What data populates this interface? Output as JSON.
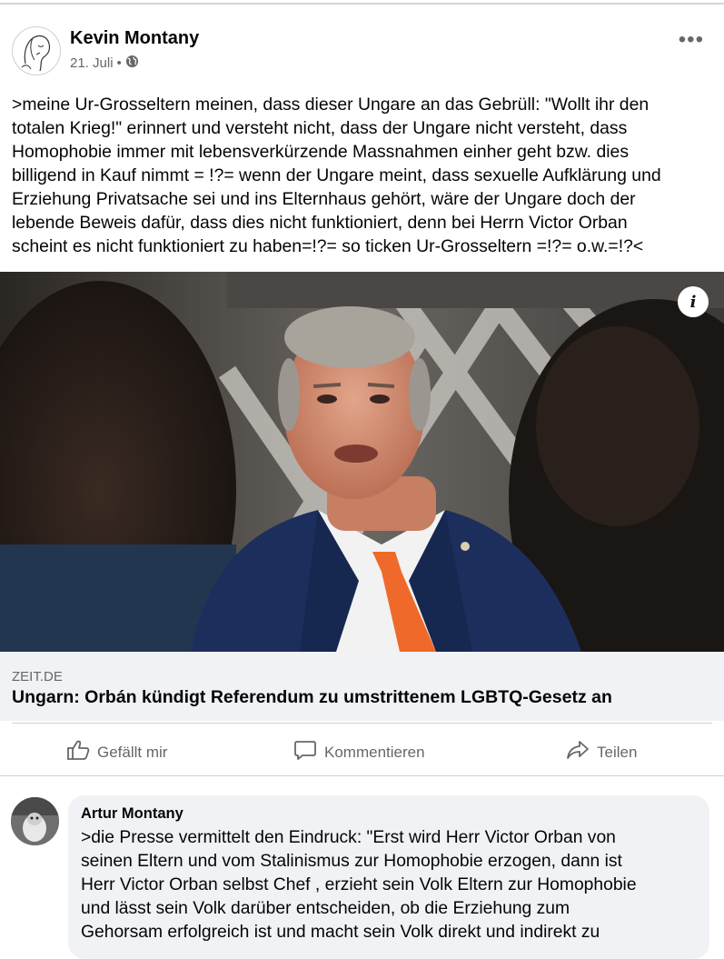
{
  "post": {
    "author": "Kevin Montany",
    "date": "21. Juli",
    "date_separator": "•",
    "audience_icon": "globe-icon",
    "more_icon": "more-horizontal-icon",
    "more_label": "•••",
    "text": ">meine Ur-Grosseltern meinen, dass dieser Ungare an das Gebrüll: \"Wollt ihr den\ntotalen Krieg!\" erinnert und versteht nicht, dass der Ungare nicht versteht, dass\nHomophobie immer mit lebensverkürzende Massnahmen einher geht bzw. dies\nbilligend in Kauf nimmt = !?= wenn der Ungare meint, dass sexuelle Aufklärung und\nErziehung Privatsache sei und ins Elternhaus gehört, wäre der Ungare doch der\nlebende Beweis dafür, dass dies nicht funktioniert, denn bei Herrn Victor Orban\nscheint es nicht funktioniert zu haben=!?= so ticken Ur-Grosseltern =!?= o.w.=!?<"
  },
  "link": {
    "info_label": "i",
    "domain": "ZEIT.DE",
    "title": "Ungarn: Orbán kündigt Referendum zu umstrittenem LGBTQ-Gesetz an"
  },
  "actions": {
    "like": {
      "label": "Gefällt mir",
      "icon": "thumbs-up-icon"
    },
    "comment": {
      "label": "Kommentieren",
      "icon": "comment-icon"
    },
    "share": {
      "label": "Teilen",
      "icon": "share-icon"
    }
  },
  "comment": {
    "author": "Artur Montany",
    "text": ">die Presse vermittelt den Eindruck: \"Erst wird Herr Victor Orban von\nseinen Eltern und vom Stalinismus zur Homophobie erzogen, dann ist\nHerr Victor Orban selbst Chef , erzieht sein Volk Eltern zur Homophobie\nund lässt sein Volk darüber entscheiden, ob die Erziehung zum\nGehorsam erfolgreich ist und macht sein Volk direkt und indirekt zu"
  },
  "colors": {
    "text": "#050505",
    "secondary_text": "#65676b",
    "link_meta_bg": "#f0f2f5",
    "tie": "#ef6a2a",
    "suit": "#1c2f5c"
  }
}
